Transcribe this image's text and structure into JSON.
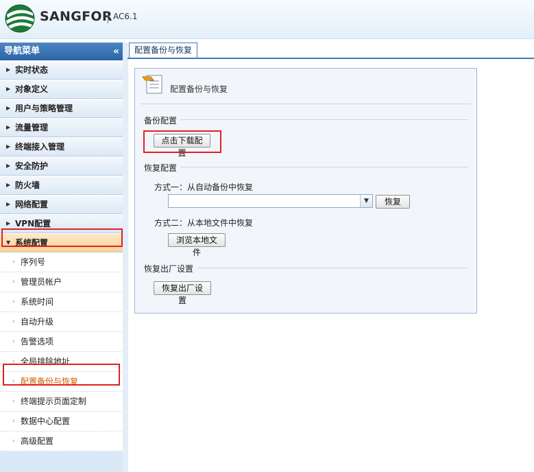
{
  "header": {
    "brand": "SANGFOR",
    "version": "AC6.1"
  },
  "sidebar": {
    "title": "导航菜单",
    "collapse_glyph": "«",
    "menu": [
      {
        "label": "实时状态"
      },
      {
        "label": "对象定义"
      },
      {
        "label": "用户与策略管理"
      },
      {
        "label": "流量管理"
      },
      {
        "label": "终端接入管理"
      },
      {
        "label": "安全防护"
      },
      {
        "label": "防火墙"
      },
      {
        "label": "网络配置"
      },
      {
        "label": "VPN配置"
      },
      {
        "label": "系统配置"
      }
    ],
    "submenu": [
      {
        "label": "序列号"
      },
      {
        "label": "管理员帐户"
      },
      {
        "label": "系统时间"
      },
      {
        "label": "自动升级"
      },
      {
        "label": "告警选项"
      },
      {
        "label": "全局排除地址"
      },
      {
        "label": "配置备份与恢复"
      },
      {
        "label": "终端提示页面定制"
      },
      {
        "label": "数据中心配置"
      },
      {
        "label": "高级配置"
      }
    ]
  },
  "main": {
    "tab_label": "配置备份与恢复",
    "panel_title": "配置备份与恢复",
    "backup": {
      "section_label": "备份配置",
      "download_button": "点击下载配置"
    },
    "restore": {
      "section_label": "恢复配置",
      "method1_label": "方式一：从自动备份中恢复",
      "select_value": "",
      "restore_button": "恢复",
      "method2_label": "方式二：从本地文件中恢复",
      "browse_button": "浏览本地文件"
    },
    "factory": {
      "section_label": "恢复出厂设置",
      "reset_button": "恢复出厂设置"
    }
  },
  "colors": {
    "nav_header": "#2b64a6",
    "active_menu_bg": "#f9d195",
    "active_sub_text": "#d45a00",
    "highlight_box": "#e02020"
  }
}
